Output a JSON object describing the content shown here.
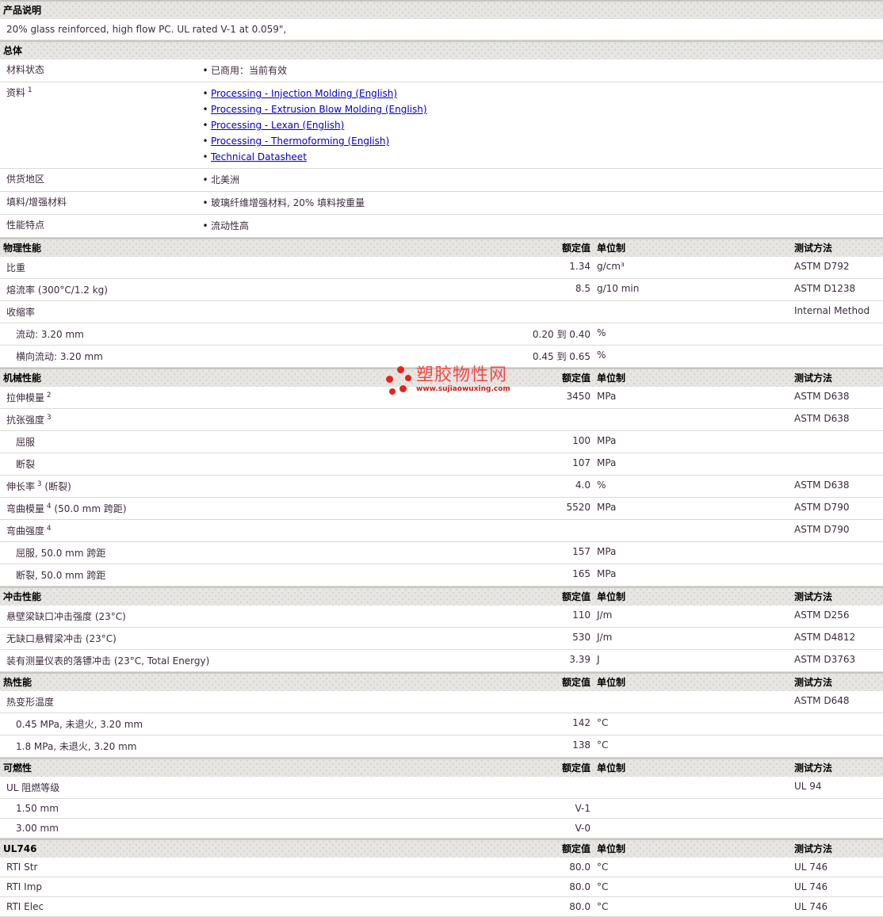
{
  "watermark": {
    "title": "塑胶物性网",
    "url_text": "www.sujiaowuxing.com",
    "accent_color": "#e8231a"
  },
  "table": {
    "columns": {
      "value": "额定值",
      "unit": "单位制",
      "method": "测试方法"
    },
    "sections": [
      {
        "id": "product-description",
        "title": "产品说明",
        "type": "plain",
        "rows": [
          {
            "text": "20% glass reinforced, high flow PC. UL rated V-1 at 0.059\","
          }
        ]
      },
      {
        "id": "general",
        "title": "总体",
        "type": "bullets",
        "rows": [
          {
            "label": "材料状态",
            "bullets": [
              {
                "text": "已商用：当前有效"
              }
            ]
          },
          {
            "label": "资料",
            "sup": "1",
            "bullets": [
              {
                "text": "Processing - Injection Molding (English)",
                "link": true
              },
              {
                "text": "Processing - Extrusion Blow Molding (English)",
                "link": true
              },
              {
                "text": "Processing - Lexan (English)",
                "link": true
              },
              {
                "text": "Processing - Thermoforming (English)",
                "link": true
              },
              {
                "text": "Technical Datasheet",
                "link": true
              }
            ]
          },
          {
            "label": "供货地区",
            "bullets": [
              {
                "text": "北美洲"
              }
            ]
          },
          {
            "label": "填料/增强材料",
            "bullets": [
              {
                "text": "玻璃纤维增强材料, 20% 填料按重量"
              }
            ]
          },
          {
            "label": "性能特点",
            "bullets": [
              {
                "text": "流动性高"
              }
            ]
          }
        ]
      },
      {
        "id": "physical",
        "title": "物理性能",
        "type": "props",
        "rows": [
          {
            "label": "比重",
            "value": "1.34",
            "unit": "g/cm³",
            "method": "ASTM D792"
          },
          {
            "label": "熔流率",
            "post": " (300°C/1.2 kg)",
            "value": "8.5",
            "unit": "g/10 min",
            "method": "ASTM D1238"
          },
          {
            "label": "收缩率",
            "method": "Internal Method"
          },
          {
            "label": "流动: 3.20 mm",
            "indent": true,
            "value": "0.20 到 0.40",
            "unit": "%"
          },
          {
            "label": "横向流动: 3.20 mm",
            "indent": true,
            "value": "0.45 到 0.65",
            "unit": "%"
          }
        ]
      },
      {
        "id": "mechanical",
        "title": "机械性能",
        "type": "props",
        "rows": [
          {
            "label": "拉伸模量",
            "sup": "2",
            "value": "3450",
            "unit": "MPa",
            "method": "ASTM D638"
          },
          {
            "label": "抗张强度",
            "sup": "3",
            "method": "ASTM D638"
          },
          {
            "label": "屈服",
            "indent": true,
            "value": "100",
            "unit": "MPa"
          },
          {
            "label": "断裂",
            "indent": true,
            "value": "107",
            "unit": "MPa"
          },
          {
            "label": "伸长率",
            "sup": "3",
            "post": " (断裂)",
            "value": "4.0",
            "unit": "%",
            "method": "ASTM D638"
          },
          {
            "label": "弯曲模量",
            "sup": "4",
            "post": " (50.0 mm 跨距)",
            "value": "5520",
            "unit": "MPa",
            "method": "ASTM D790"
          },
          {
            "label": "弯曲强度",
            "sup": "4",
            "method": "ASTM D790"
          },
          {
            "label": "屈服, 50.0 mm 跨距",
            "indent": true,
            "value": "157",
            "unit": "MPa"
          },
          {
            "label": "断裂, 50.0 mm 跨距",
            "indent": true,
            "value": "165",
            "unit": "MPa"
          }
        ]
      },
      {
        "id": "impact",
        "title": "冲击性能",
        "type": "props",
        "rows": [
          {
            "label": "悬壁梁缺口冲击强度 (23°C)",
            "value": "110",
            "unit": "J/m",
            "method": "ASTM D256"
          },
          {
            "label": "无缺口悬臂梁冲击 (23°C)",
            "value": "530",
            "unit": "J/m",
            "method": "ASTM D4812"
          },
          {
            "label": "装有测量仪表的落镖冲击 (23°C, Total Energy)",
            "value": "3.39",
            "unit": "J",
            "method": "ASTM D3763"
          }
        ]
      },
      {
        "id": "thermal",
        "title": "热性能",
        "type": "props",
        "rows": [
          {
            "label": "热变形温度",
            "method": "ASTM D648"
          },
          {
            "label": "0.45 MPa, 未退火, 3.20 mm",
            "indent": true,
            "value": "142",
            "unit": "°C"
          },
          {
            "label": "1.8 MPa, 未退火, 3.20 mm",
            "indent": true,
            "value": "138",
            "unit": "°C"
          }
        ]
      },
      {
        "id": "flammability",
        "title": "可燃性",
        "type": "props",
        "rows": [
          {
            "label": "UL 阻燃等级",
            "method": "UL 94"
          },
          {
            "label": "1.50 mm",
            "indent": true,
            "value": "V-1"
          },
          {
            "label": "3.00 mm",
            "indent": true,
            "value": "V-0"
          }
        ]
      },
      {
        "id": "ul746",
        "title": "UL746",
        "type": "props",
        "rows": [
          {
            "label": "RTI Str",
            "value": "80.0",
            "unit": "°C",
            "method": "UL 746"
          },
          {
            "label": "RTI Imp",
            "value": "80.0",
            "unit": "°C",
            "method": "UL 746"
          },
          {
            "label": "RTI Elec",
            "value": "80.0",
            "unit": "°C",
            "method": "UL 746"
          }
        ]
      }
    ]
  }
}
